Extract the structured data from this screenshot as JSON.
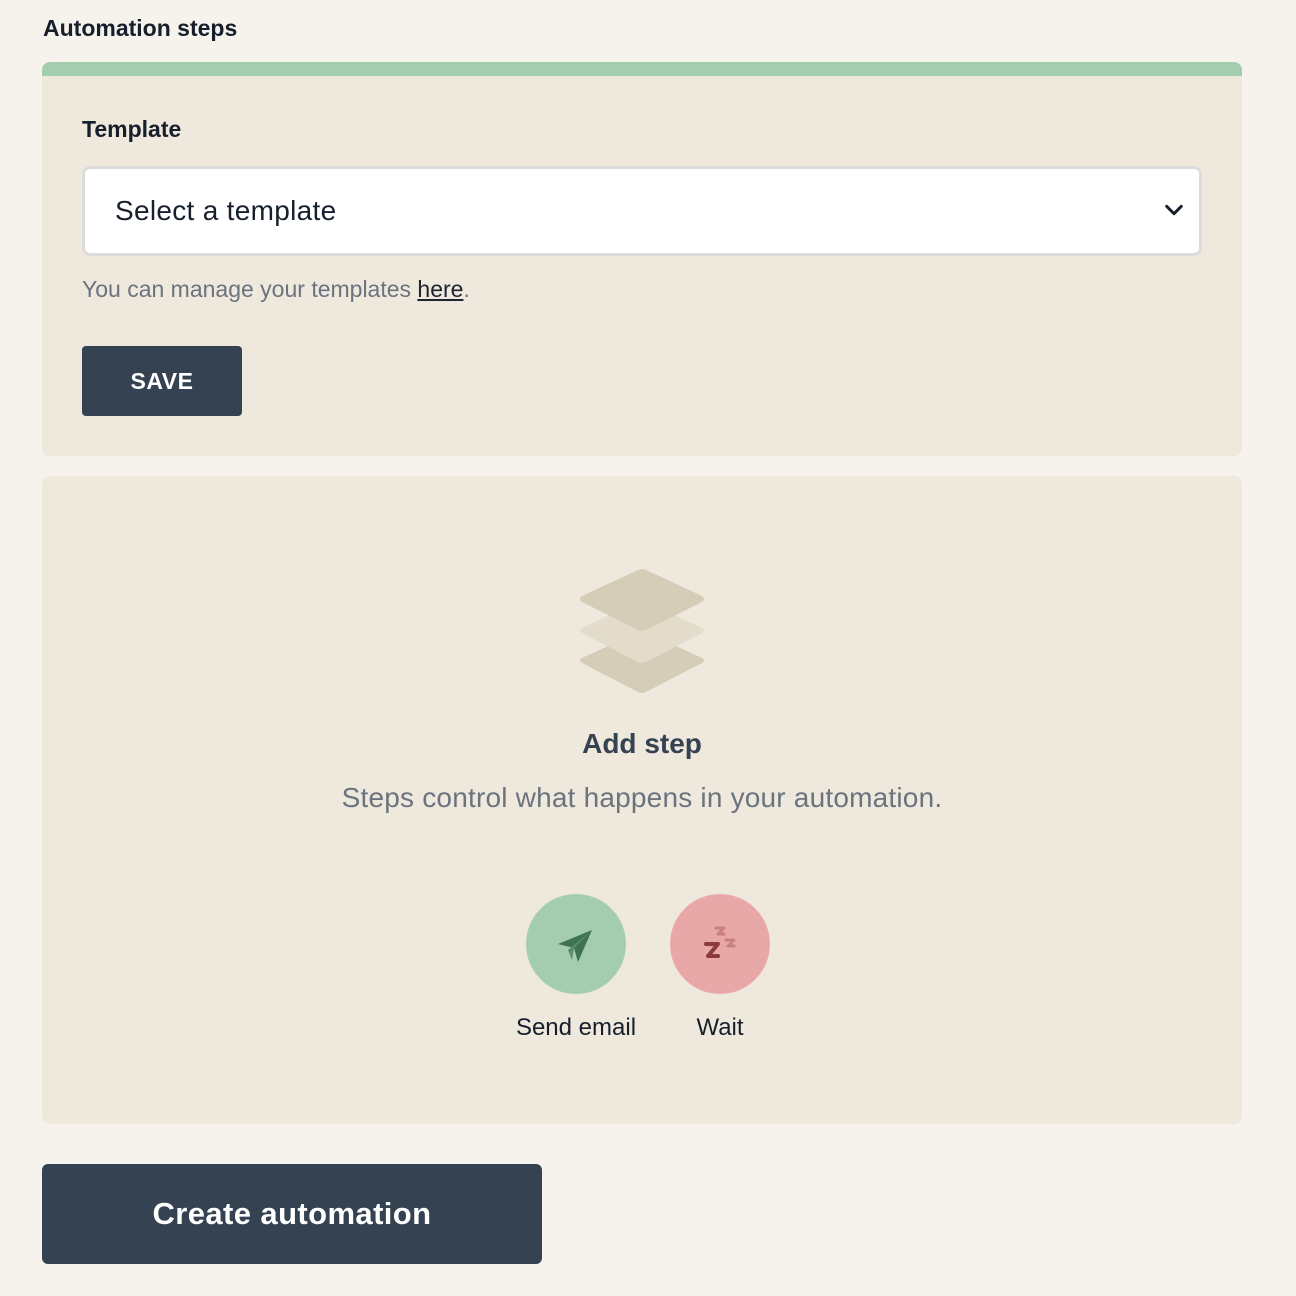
{
  "section": {
    "title": "Automation steps"
  },
  "template_card": {
    "accent_color": "#a4cdb0",
    "label": "Template",
    "select": {
      "selected_value": "Select a template"
    },
    "help_prefix": "You can manage your templates ",
    "help_link": "here",
    "help_suffix": ".",
    "save_label": "SAVE"
  },
  "add_step": {
    "icon": "layers-icon",
    "title": "Add step",
    "description": "Steps control what happens in your automation.",
    "options": [
      {
        "label": "Send email",
        "icon": "paper-plane-icon",
        "color": "#a4cdb0"
      },
      {
        "label": "Wait",
        "icon": "sleep-zzz-icon",
        "color": "#e8a8a8"
      }
    ]
  },
  "footer": {
    "create_label": "Create automation"
  },
  "colors": {
    "background": "#f6f3ec",
    "card": "#efe8dd",
    "primary_button": "#354252"
  }
}
